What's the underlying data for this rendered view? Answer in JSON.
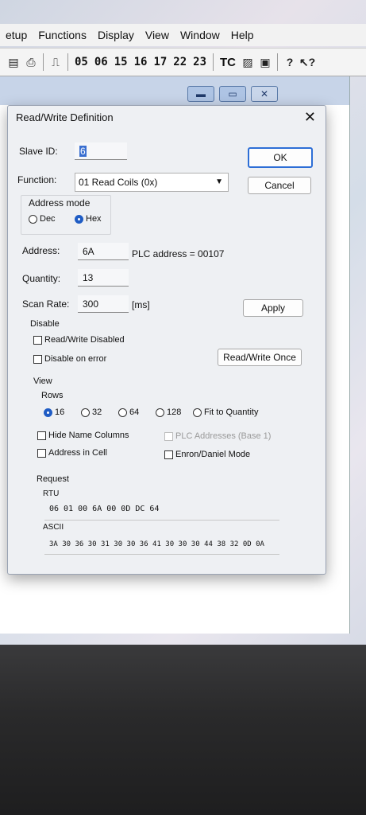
{
  "menubar": [
    "etup",
    "Functions",
    "Display",
    "View",
    "Window",
    "Help"
  ],
  "toolbar": {
    "function_codes": [
      "05",
      "06",
      "15",
      "16",
      "17",
      "22",
      "23"
    ],
    "tc_label": "TC",
    "icons": [
      "connect-icon",
      "disconnect-icon",
      "read-once-icon",
      "tc-icon",
      "chart-icon",
      "monitor-icon",
      "help-icon",
      "whats-this-icon"
    ]
  },
  "window_buttons": {
    "minimize": "▬",
    "restore": "▭",
    "close": "✕"
  },
  "dialog": {
    "title": "Read/Write Definition",
    "close": "✕",
    "slave_id_label": "Slave ID:",
    "slave_id_value": "6",
    "function_label": "Function:",
    "function_value": "01 Read Coils (0x)",
    "address_mode_label": "Address mode",
    "dec_label": "Dec",
    "hex_label": "Hex",
    "address_label": "Address:",
    "address_value": "6A",
    "plc_address": "PLC address = 00107",
    "quantity_label": "Quantity:",
    "quantity_value": "13",
    "scan_rate_label": "Scan Rate:",
    "scan_rate_value": "300",
    "scan_rate_unit": "[ms]",
    "ok": "OK",
    "cancel": "Cancel",
    "apply": "Apply",
    "disable_label": "Disable",
    "rw_disabled": "Read/Write Disabled",
    "disable_on_error": "Disable on error",
    "read_write_once": "Read/Write Once",
    "view_label": "View",
    "rows_label": "Rows",
    "rows_options": [
      "16",
      "32",
      "64",
      "128",
      "Fit to Quantity"
    ],
    "rows_selected": "16",
    "hide_name_columns": "Hide Name Columns",
    "plc_addresses_base1": "PLC Addresses (Base 1)",
    "address_in_cell": "Address in Cell",
    "enron_daniel": "Enron/Daniel Mode",
    "request_label": "Request",
    "rtu_label": "RTU",
    "rtu_value": "06 01 00 6A 00 0D DC 64",
    "ascii_label": "ASCII",
    "ascii_value": "3A 30 36 30 31 30 30 36 41 30 30 30 44 38 32 0D 0A"
  },
  "colors": {
    "accent": "#1f5cc4",
    "dialog_bg": "#eef0f3"
  }
}
